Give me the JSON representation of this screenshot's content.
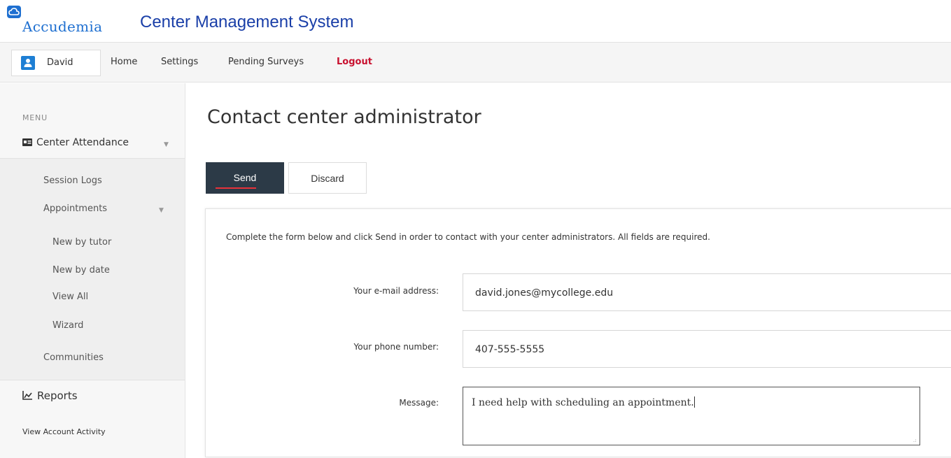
{
  "header": {
    "logo_text": "Accudemia",
    "app_title": "Center Management System"
  },
  "nav": {
    "user_name": "David",
    "links": [
      "Home",
      "Settings",
      "Pending Surveys"
    ],
    "logout_label": "Logout"
  },
  "sidebar": {
    "menu_heading": "MENU",
    "section_label": "Center Attendance",
    "session_logs": "Session Logs",
    "appointments": "Appointments",
    "appointment_items": [
      "New by tutor",
      "New by date",
      "View All",
      "Wizard"
    ],
    "communities": "Communities",
    "reports": "Reports",
    "view_account_activity": "View Account Activity"
  },
  "main": {
    "title": "Contact center administrator",
    "send_label": "Send",
    "discard_label": "Discard",
    "instructions": "Complete the form below and click Send in order to contact with your center administrators. All fields are required.",
    "email_label": "Your e-mail address:",
    "email_value": "david.jones@mycollege.edu",
    "phone_label": "Your phone number:",
    "phone_value": "407-555-5555",
    "message_label": "Message:",
    "message_value": "I need help with scheduling an appointment."
  },
  "colors": {
    "brand_blue": "#1e6fd0",
    "title_blue": "#1a3fa8",
    "logout_red": "#c8102e",
    "send_bg": "#2c3a47",
    "send_underline": "#e8323a"
  }
}
